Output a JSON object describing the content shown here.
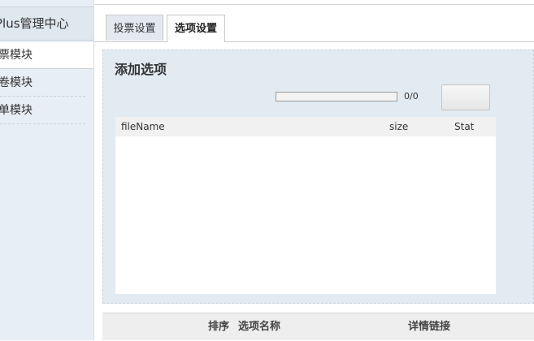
{
  "sidebar": {
    "title": "Plus管理中心",
    "items": [
      {
        "label": "票模块",
        "active": true
      },
      {
        "label": "卷模块",
        "active": false
      },
      {
        "label": "单模块",
        "active": false
      }
    ]
  },
  "tabs": [
    {
      "label": "投票设置",
      "active": false
    },
    {
      "label": "选项设置",
      "active": true
    }
  ],
  "panel": {
    "title": "添加选项",
    "progress_text": "0/0",
    "progress": 0,
    "file_table": {
      "columns": [
        "fileName",
        "size",
        "Stat"
      ]
    }
  },
  "list": {
    "columns": [
      "排序",
      "选项名称",
      "详情链接"
    ]
  },
  "colors": {
    "panel_bg": "#e3ebf2",
    "sidebar_bg": "#e8eef5"
  }
}
